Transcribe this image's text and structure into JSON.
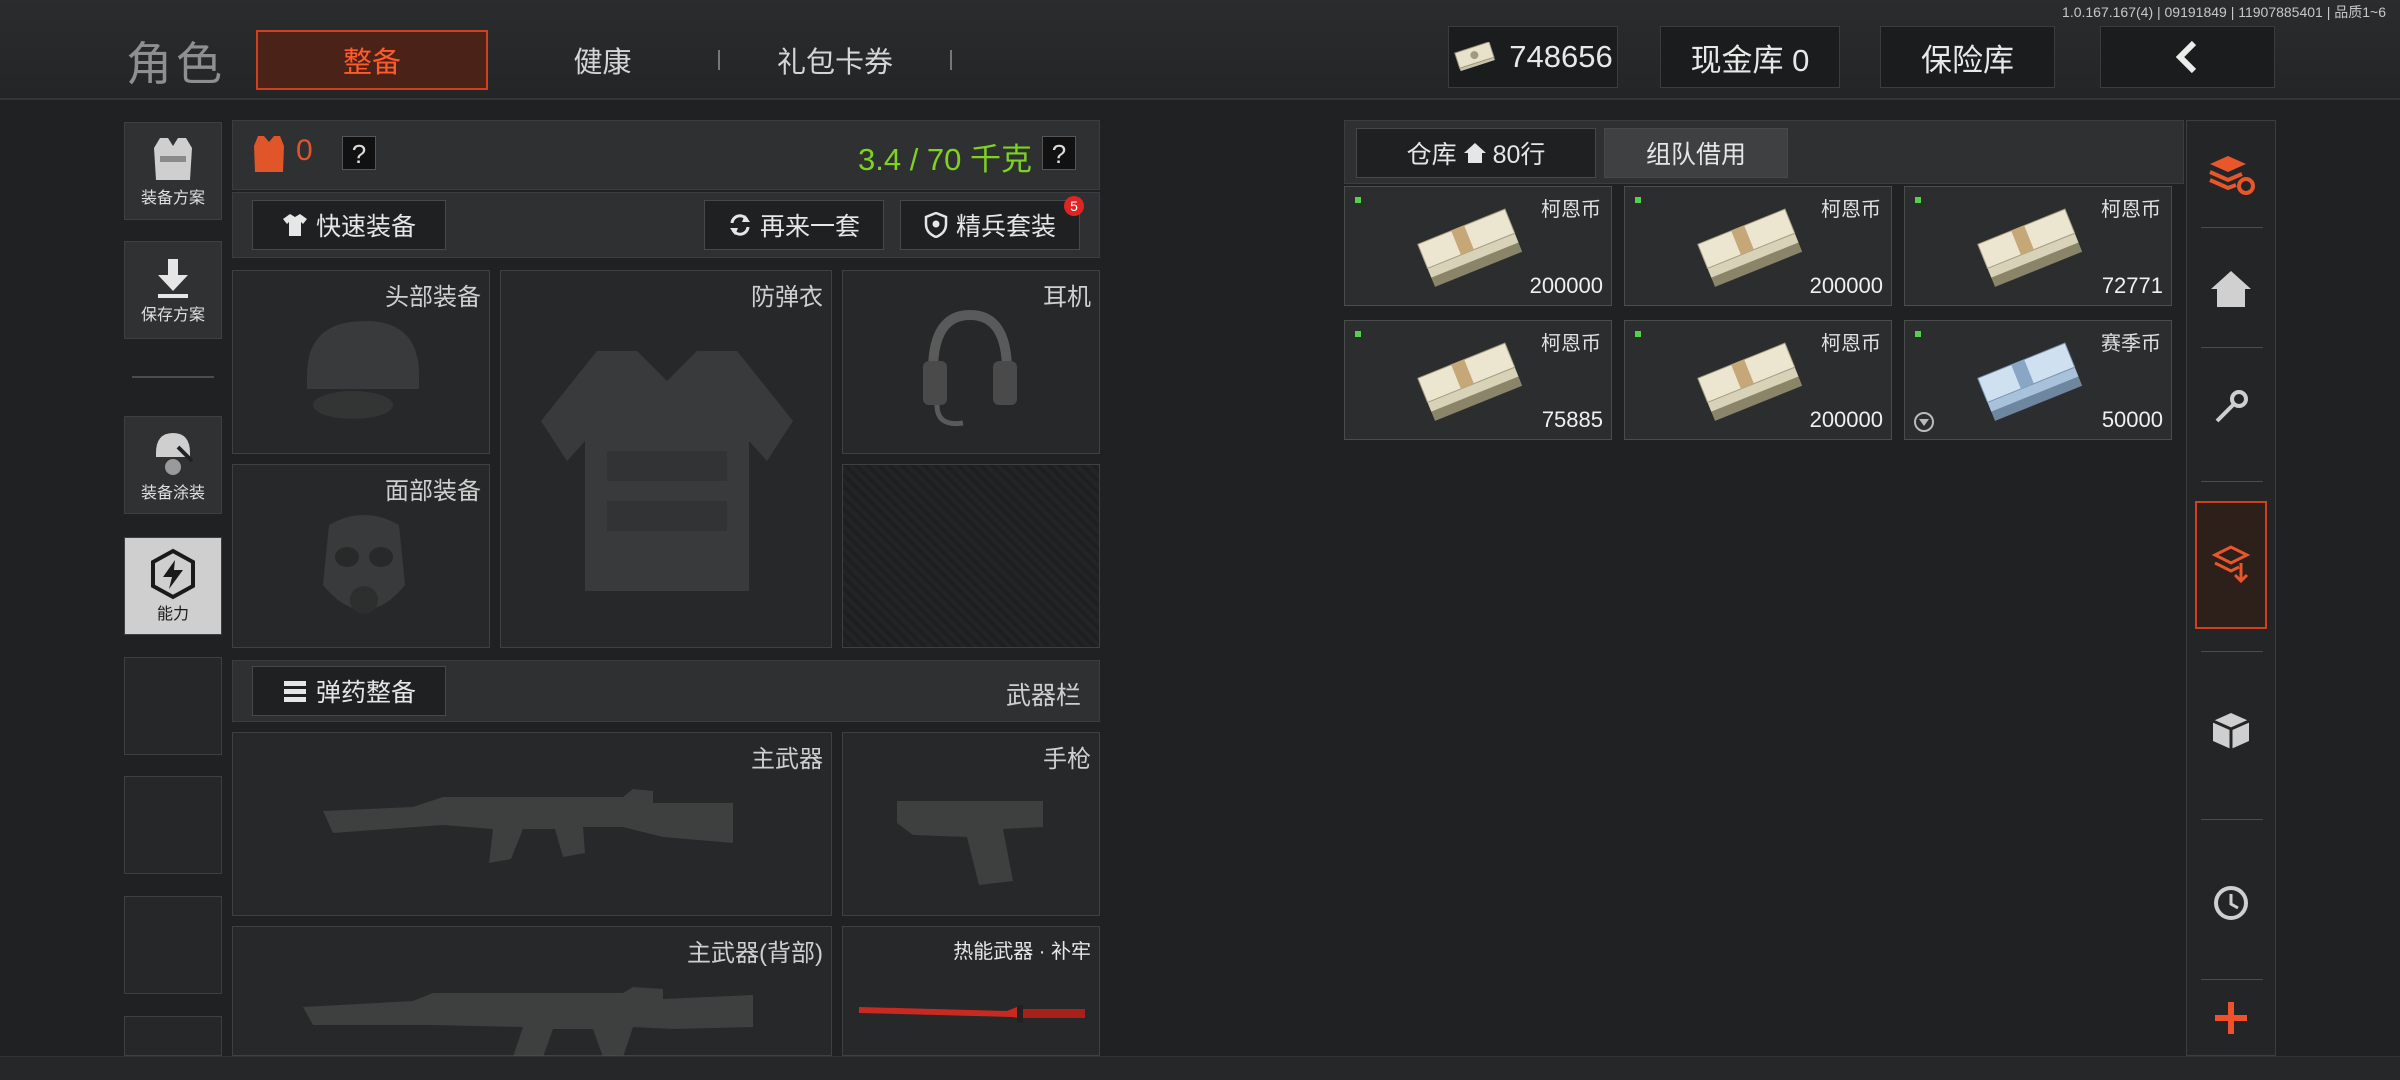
{
  "version": "1.0.167.167(4) | 09191849 | 11907885401 | 品质1~6",
  "title": "角色",
  "tabs": [
    "整备",
    "健康",
    "礼包卡券"
  ],
  "header": {
    "money": "748656",
    "cash_vault": "现金库 0",
    "safe": "保险库"
  },
  "sidebar": [
    "装备方案",
    "保存方案",
    "装备涂装",
    "能力"
  ],
  "equip": {
    "armor_count": "0",
    "help": "?",
    "weight": "3.4 / 70 千克",
    "quick_equip": "快速装备",
    "again": "再来一套",
    "elite": "精兵套装",
    "elite_badge": "5",
    "slots": {
      "head": "头部装备",
      "vest": "防弹衣",
      "ear": "耳机",
      "face": "面部装备"
    },
    "ammo": "弹药整备",
    "weapon_bar": "武器栏",
    "weapons": {
      "primary": "主武器",
      "pistol": "手枪",
      "back": "主武器(背部)",
      "melee": "热能武器 · 补牢"
    }
  },
  "storage": {
    "tabs": {
      "warehouse": "仓库",
      "rows": "80行",
      "team": "组队借用"
    },
    "items": [
      {
        "name": "柯恩币",
        "count": "200000"
      },
      {
        "name": "柯恩币",
        "count": "200000"
      },
      {
        "name": "柯恩币",
        "count": "72771"
      },
      {
        "name": "柯恩币",
        "count": "75885"
      },
      {
        "name": "柯恩币",
        "count": "200000"
      },
      {
        "name": "赛季币",
        "count": "50000"
      }
    ]
  },
  "colors": {
    "accent": "#ff5a2a",
    "weight": "#7ed321",
    "bg": "#1f2122"
  }
}
